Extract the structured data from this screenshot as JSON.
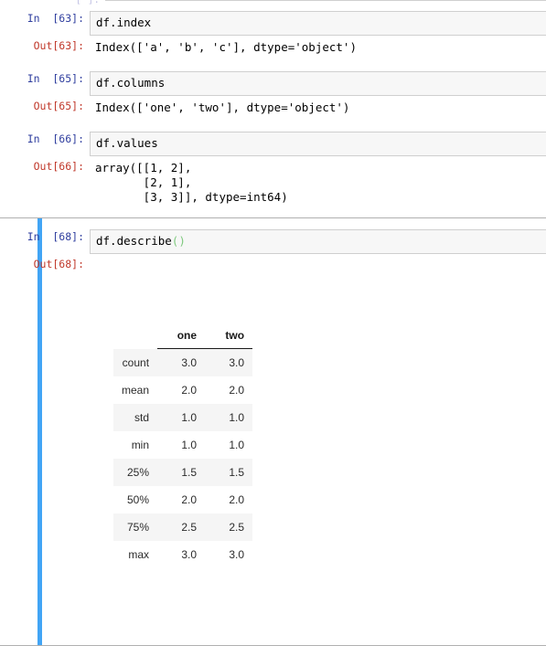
{
  "notebook": {
    "top_partial_cell": {
      "prompt_text": "[ ]:"
    },
    "cells": [
      {
        "id": "cell-index",
        "selected": false,
        "in_prompt": "In  [63]:",
        "in_label": "In",
        "in_number": "[63]",
        "source": "df.index",
        "out_prompt": "Out[63]:",
        "out_label": "Out",
        "out_number": "[63]",
        "output_text": "Index(['a', 'b', 'c'], dtype='object')"
      },
      {
        "id": "cell-columns",
        "selected": false,
        "in_prompt": "In  [65]:",
        "in_label": "In",
        "in_number": "[65]",
        "source": "df.columns",
        "out_prompt": "Out[65]:",
        "out_label": "Out",
        "out_number": "[65]",
        "output_text": "Index(['one', 'two'], dtype='object')"
      },
      {
        "id": "cell-values",
        "selected": false,
        "in_prompt": "In  [66]:",
        "in_label": "In",
        "in_number": "[66]",
        "source": "df.values",
        "out_prompt": "Out[66]:",
        "out_label": "Out",
        "out_number": "[66]",
        "output_text": "array([[1, 2],\n       [2, 1],\n       [3, 3]], dtype=int64)"
      },
      {
        "id": "cell-describe",
        "selected": true,
        "in_prompt": "In  [68]:",
        "in_label": "In",
        "in_number": "[68]",
        "source_prefix": "df.describe",
        "source_parens": "()",
        "out_prompt": "Out[68]:",
        "out_label": "Out",
        "out_number": "[68]"
      }
    ],
    "dataframe": {
      "corner_label": "",
      "columns": [
        "one",
        "two"
      ],
      "index": [
        "count",
        "mean",
        "std",
        "min",
        "25%",
        "50%",
        "75%",
        "max"
      ],
      "rows": [
        [
          "3.0",
          "3.0"
        ],
        [
          "2.0",
          "2.0"
        ],
        [
          "1.0",
          "1.0"
        ],
        [
          "1.0",
          "1.0"
        ],
        [
          "1.5",
          "1.5"
        ],
        [
          "2.0",
          "2.0"
        ],
        [
          "2.5",
          "2.5"
        ],
        [
          "3.0",
          "3.0"
        ]
      ]
    },
    "colors": {
      "in_prompt": "#303f9f",
      "out_prompt": "#c0392b",
      "selected_bar": "#42a5f5",
      "input_bg": "#f7f7f7",
      "input_border": "#cfcfcf",
      "row_stripe": "#f5f5f5",
      "syntax_paren": "#7fc97f"
    }
  }
}
